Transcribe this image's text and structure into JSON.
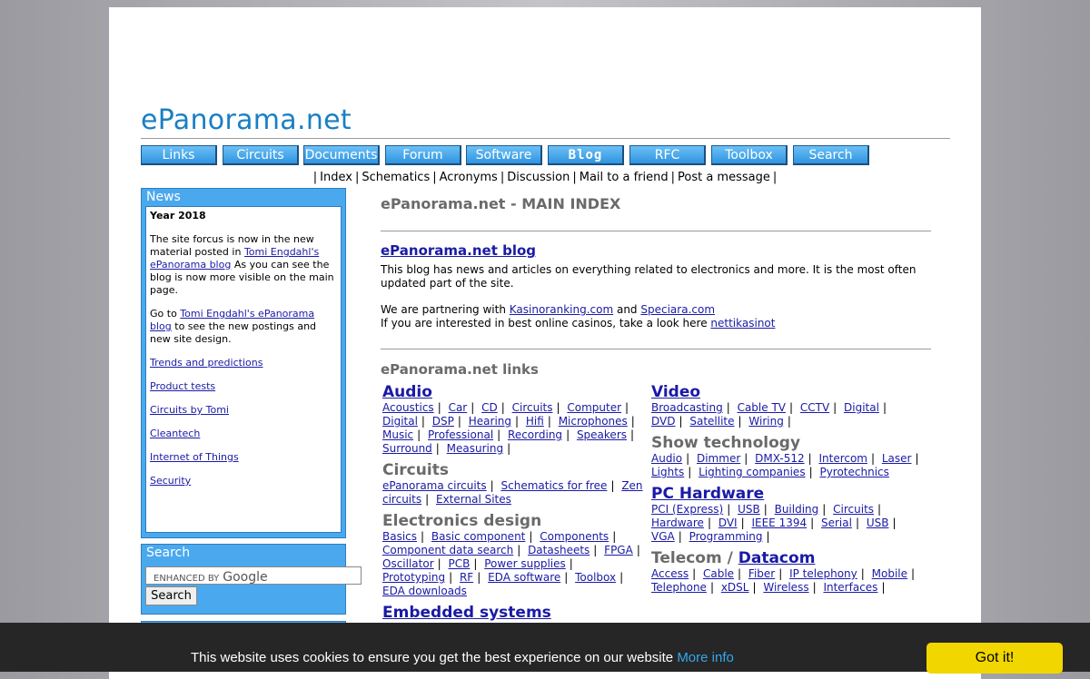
{
  "site": {
    "logo": "ePanorama.net"
  },
  "nav": {
    "buttons": [
      "Links",
      "Circuits",
      "Documents",
      "Forum",
      "Software",
      "Blog",
      "RFC",
      "Toolbox",
      "Search"
    ]
  },
  "subnav": [
    "Index",
    "Schematics",
    "Acronyms",
    "Discussion",
    "Mail to a friend",
    "Post a message"
  ],
  "sidebar": {
    "news": {
      "title": "News",
      "year": "Year 2018",
      "p1_pre": "The site forcus is now in the new material posted in ",
      "p1_link": "Tomi Engdahl's ePanorama blog",
      "p1_post": " As you can see the blog is now more visible on the main page.",
      "p2_pre": "Go to ",
      "p2_link": "Tomi Engdahl's ePanorama blog",
      "p2_post": " to see the new postings and new site design.",
      "links": [
        "Trends and predictions",
        "Product tests",
        "Circuits by Tomi",
        "Cleantech",
        "Internet of Things",
        "Security"
      ]
    },
    "search": {
      "title": "Search",
      "placeholder": "ENHANCED BY",
      "brand": "Google",
      "button": "Search"
    }
  },
  "main": {
    "title": "ePanorama.net - MAIN INDEX",
    "blog": {
      "title": "ePanorama.net blog",
      "text": "This blog has news and articles on everything related to electronics and more. It is the most often updated part of the site.",
      "partner_pre": "We are partnering with ",
      "partner1": "Kasinoranking.com",
      "partner_mid": " and ",
      "partner2": "Speciara.com",
      "casino_pre": "If you are interested in best online casinos, take a look here ",
      "casino_link": "nettikasinot"
    },
    "links_title": "ePanorama.net links",
    "left_col": [
      {
        "title": "Audio",
        "link": true,
        "items": [
          "Acoustics",
          "Car",
          "CD",
          "Circuits",
          "Computer",
          "Digital",
          "DSP",
          "Hearing",
          "Hifi",
          "Microphones",
          "Music",
          "Professional",
          "Recording",
          "Speakers",
          "Surround",
          "Measuring"
        ]
      },
      {
        "title": "Circuits",
        "link": false,
        "items": [
          "ePanorama circuits",
          "Schematics for free",
          "Zen circuits",
          "External Sites"
        ]
      },
      {
        "title": "Electronics design",
        "link": false,
        "items": [
          "Basics",
          "Basic component",
          "Components",
          "Component data search",
          "Datasheets",
          "FPGA",
          "Oscillator",
          "PCB",
          "Power supplies",
          "Prototyping",
          "RF",
          "EDA software",
          "Toolbox",
          "EDA downloads"
        ]
      },
      {
        "title": "Embedded systems",
        "link": true,
        "items": []
      }
    ],
    "right_col": [
      {
        "title": "Video",
        "link": true,
        "items": [
          "Broadcasting",
          "Cable TV",
          "CCTV",
          "Digital",
          "DVD",
          "Satellite",
          "Wiring"
        ]
      },
      {
        "title": "Show technology",
        "link": false,
        "items": [
          "Audio",
          "Dimmer",
          "DMX-512",
          "Intercom",
          "Laser",
          "Lights",
          "Lighting companies",
          "Pyrotechnics"
        ]
      },
      {
        "title": "PC Hardware",
        "link": true,
        "items": [
          "PCI (Express)",
          "USB",
          "Building",
          "Circuits",
          "Hardware",
          "DVI",
          "IEEE 1394",
          "Serial",
          "USB",
          "VGA",
          "Programming"
        ]
      },
      {
        "title_pre": "Telecom / ",
        "title": "Datacom",
        "link": true,
        "items": [
          "Access",
          "Cable",
          "Fiber",
          "IP telephony",
          "Mobile",
          "Telephone",
          "xDSL",
          "Wireless",
          "Interfaces"
        ]
      }
    ]
  },
  "cookie": {
    "text": "This website uses cookies to ensure you get the best experience on our website",
    "more": "More info",
    "button": "Got it!"
  }
}
